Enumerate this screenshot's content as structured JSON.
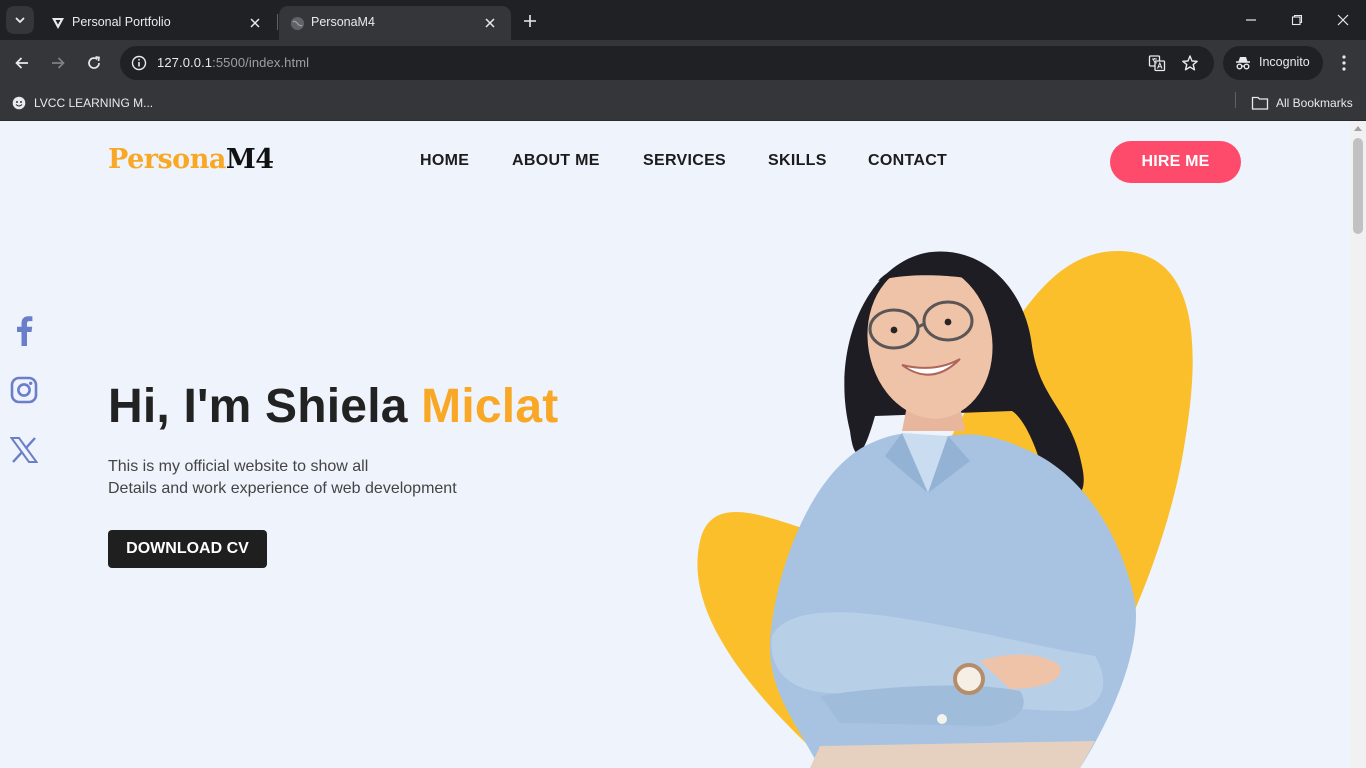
{
  "browser": {
    "tabs": [
      {
        "title": "Personal Portfolio",
        "active": false,
        "favicon": "vercel-triangle-icon"
      },
      {
        "title": "PersonaM4",
        "active": true,
        "favicon": "globe-icon"
      }
    ],
    "url_host": "127.0.0.1",
    "url_rest": ":5500/index.html",
    "incognito_label": "Incognito",
    "bookmarks": [
      {
        "label": "LVCC LEARNING M..."
      }
    ],
    "all_bookmarks_label": "All Bookmarks"
  },
  "page": {
    "logo": {
      "part1": "Persona",
      "part2": "M4"
    },
    "nav": [
      "HOME",
      "ABOUT ME",
      "SERVICES",
      "SKILLS",
      "CONTACT"
    ],
    "hire_label": "HIRE ME",
    "social": [
      "facebook-icon",
      "instagram-icon",
      "x-twitter-icon"
    ],
    "headline": {
      "prefix": "Hi, I'm Shiela ",
      "highlight": "Miclat"
    },
    "subtext": [
      "This is my official website to show all",
      "Details and work experience of web development"
    ],
    "cv_label": "DOWNLOAD CV",
    "colors": {
      "accent": "#f9a826",
      "hire": "#ff4b6b",
      "bg": "#eef3fc",
      "blob": "#fbbf2c"
    }
  }
}
